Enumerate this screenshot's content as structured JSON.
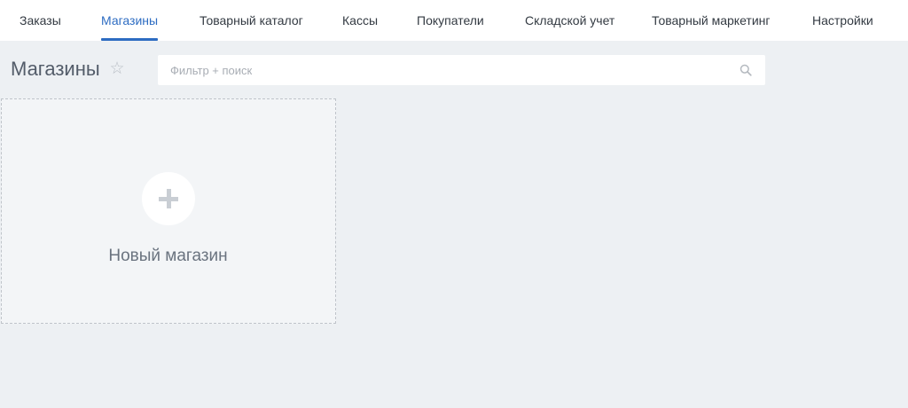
{
  "nav": {
    "tabs": [
      {
        "label": "Заказы",
        "active": false
      },
      {
        "label": "Магазины",
        "active": true
      },
      {
        "label": "Товарный каталог",
        "active": false
      },
      {
        "label": "Кассы",
        "active": false
      },
      {
        "label": "Покупатели",
        "active": false
      },
      {
        "label": "Складской учет",
        "active": false
      },
      {
        "label": "Товарный маркетинг",
        "active": false
      },
      {
        "label": "Настройки",
        "active": false
      }
    ]
  },
  "header": {
    "title": "Магазины",
    "favorite_icon": "star-outline-icon"
  },
  "search": {
    "value": "",
    "placeholder": "Фильтр + поиск",
    "icon": "search-icon"
  },
  "cards": {
    "new_store_label": "Новый магазин",
    "new_store_icon": "plus-icon"
  },
  "colors": {
    "accent": "#2d6cc2",
    "background": "#edf0f3"
  }
}
